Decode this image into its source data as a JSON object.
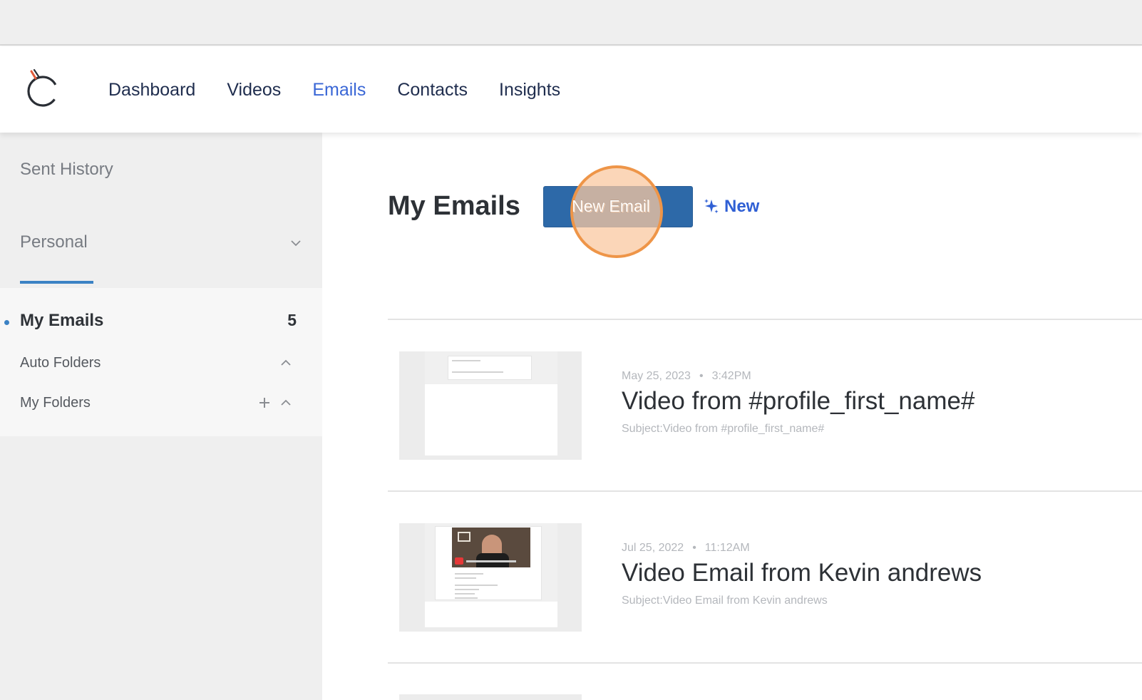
{
  "nav": {
    "links": [
      {
        "label": "Dashboard",
        "active": false
      },
      {
        "label": "Videos",
        "active": false
      },
      {
        "label": "Emails",
        "active": true
      },
      {
        "label": "Contacts",
        "active": false
      },
      {
        "label": "Insights",
        "active": false
      }
    ]
  },
  "sidebar": {
    "sent_history": "Sent History",
    "personal": "Personal",
    "my_emails": {
      "label": "My Emails",
      "count": "5"
    },
    "auto_folders": "Auto Folders",
    "my_folders": "My Folders"
  },
  "main": {
    "title": "My Emails",
    "new_email_button": "New Email",
    "ai_new_label": "New"
  },
  "emails": [
    {
      "date": "May 25, 2023",
      "time": "3:42PM",
      "title": "Video from #profile_first_name#",
      "subject": "Subject:Video from #profile_first_name#"
    },
    {
      "date": "Jul 25, 2022",
      "time": "11:12AM",
      "title": "Video Email from Kevin andrews",
      "subject": "Subject:Video Email from Kevin andrews"
    }
  ],
  "colors": {
    "accent": "#3a67d6",
    "button": "#2d69a8",
    "highlight_ring": "#ee9548",
    "sidebar_bg": "#efefef"
  }
}
